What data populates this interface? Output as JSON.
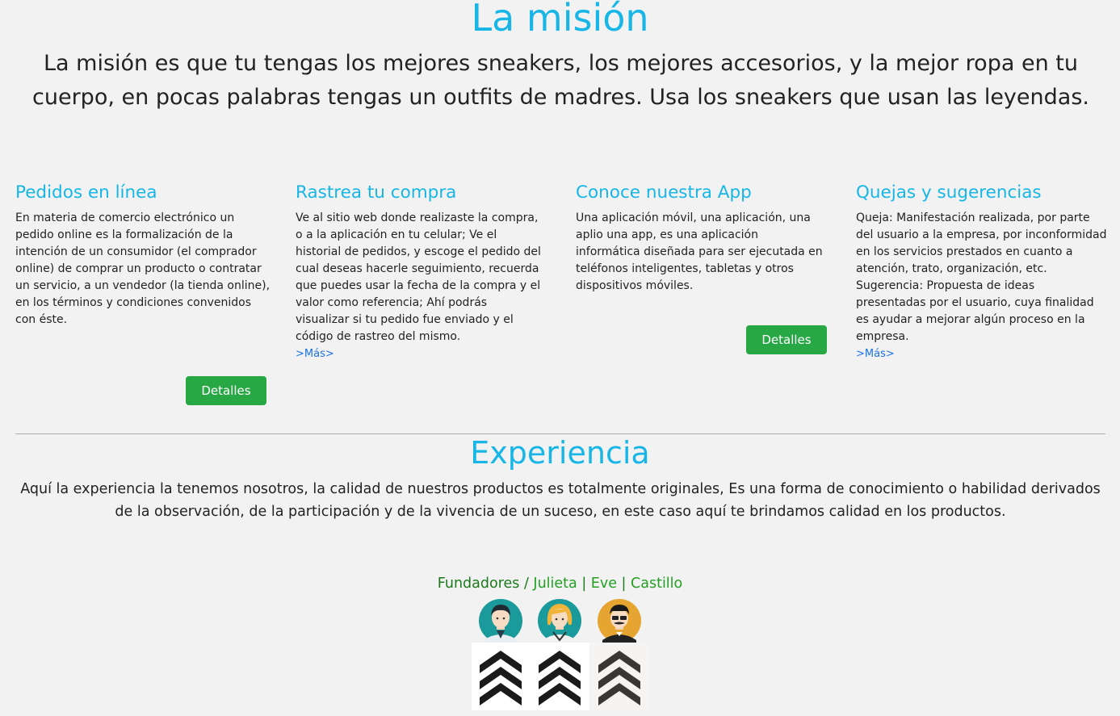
{
  "mission": {
    "title": "La misión",
    "text": "La misión es que tu tengas los mejores sneakers, los mejores accesorios, y la mejor ropa en tu cuerpo, en pocas palabras tengas un outfits de madres. Usa los sneakers que usan las leyendas."
  },
  "cards": [
    {
      "title": "Pedidos en línea",
      "text": "En materia de comercio electrónico un pedido online es la formalización de la intención de un consumidor (el comprador online) de comprar un producto o contratar un servicio, a un vendedor (la tienda online), en los términos y condiciones convenidos con éste.",
      "button": "Detalles"
    },
    {
      "title": "Rastrea tu compra",
      "text": "Ve al sitio web donde realizaste la compra, o a la aplicación en tu celular; Ve el historial de pedidos, y escoge el pedido del cual deseas hacerle seguimiento, recuerda que puedes usar la fecha de la compra y el valor como referencia; Ahí podrás visualizar si tu pedido fue enviado y el código de rastreo del mismo.",
      "more": ">Más>"
    },
    {
      "title": "Conoce nuestra App",
      "text": "Una aplicación móvil, una aplicación, una aplio una app, es una aplicación informática diseñada para ser ejecutada en teléfonos inteligentes, tabletas y otros dispositivos móviles.",
      "button": "Detalles"
    },
    {
      "title": "Quejas y sugerencias",
      "text": "Queja: Manifestación realizada, por parte del usuario a la empresa, por inconformidad en los servicios prestados en cuanto a atención, trato, organización, etc. Sugerencia: Propuesta de ideas presentadas por el usuario, cuya finalidad es ayudar a mejorar algún proceso en la empresa.",
      "more": ">Más>"
    }
  ],
  "experience": {
    "title": "Experiencia",
    "text": "Aquí la experiencia la tenemos nosotros, la calidad de nuestros productos es totalmente originales, Es una forma de conocimiento o habilidad derivados de la observación, de la participación y de la vivencia de un suceso, en este caso aquí te brindamos calidad en los productos."
  },
  "founders": {
    "label": "Fundadores",
    "slash": " / ",
    "names": [
      "Julieta",
      "Eve",
      "Castillo"
    ],
    "separator": " | "
  },
  "colors": {
    "accent": "#17b6e6",
    "button": "#28a745",
    "link": "#1a73e8",
    "founders_label": "#1b7a1b",
    "founders_names": "#22a022"
  },
  "icons": [
    "avatar-man-icon",
    "avatar-woman-icon",
    "avatar-mustache-man-icon",
    "chevron-rank-icon"
  ]
}
